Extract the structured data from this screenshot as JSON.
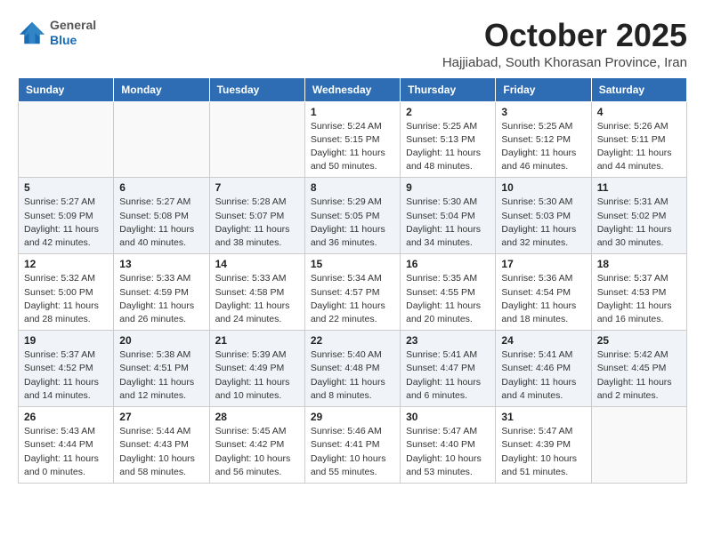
{
  "logo": {
    "general": "General",
    "blue": "Blue"
  },
  "header": {
    "month": "October 2025",
    "location": "Hajjiabad, South Khorasan Province, Iran"
  },
  "weekdays": [
    "Sunday",
    "Monday",
    "Tuesday",
    "Wednesday",
    "Thursday",
    "Friday",
    "Saturday"
  ],
  "weeks": [
    [
      {
        "day": "",
        "info": ""
      },
      {
        "day": "",
        "info": ""
      },
      {
        "day": "",
        "info": ""
      },
      {
        "day": "1",
        "info": "Sunrise: 5:24 AM\nSunset: 5:15 PM\nDaylight: 11 hours\nand 50 minutes."
      },
      {
        "day": "2",
        "info": "Sunrise: 5:25 AM\nSunset: 5:13 PM\nDaylight: 11 hours\nand 48 minutes."
      },
      {
        "day": "3",
        "info": "Sunrise: 5:25 AM\nSunset: 5:12 PM\nDaylight: 11 hours\nand 46 minutes."
      },
      {
        "day": "4",
        "info": "Sunrise: 5:26 AM\nSunset: 5:11 PM\nDaylight: 11 hours\nand 44 minutes."
      }
    ],
    [
      {
        "day": "5",
        "info": "Sunrise: 5:27 AM\nSunset: 5:09 PM\nDaylight: 11 hours\nand 42 minutes."
      },
      {
        "day": "6",
        "info": "Sunrise: 5:27 AM\nSunset: 5:08 PM\nDaylight: 11 hours\nand 40 minutes."
      },
      {
        "day": "7",
        "info": "Sunrise: 5:28 AM\nSunset: 5:07 PM\nDaylight: 11 hours\nand 38 minutes."
      },
      {
        "day": "8",
        "info": "Sunrise: 5:29 AM\nSunset: 5:05 PM\nDaylight: 11 hours\nand 36 minutes."
      },
      {
        "day": "9",
        "info": "Sunrise: 5:30 AM\nSunset: 5:04 PM\nDaylight: 11 hours\nand 34 minutes."
      },
      {
        "day": "10",
        "info": "Sunrise: 5:30 AM\nSunset: 5:03 PM\nDaylight: 11 hours\nand 32 minutes."
      },
      {
        "day": "11",
        "info": "Sunrise: 5:31 AM\nSunset: 5:02 PM\nDaylight: 11 hours\nand 30 minutes."
      }
    ],
    [
      {
        "day": "12",
        "info": "Sunrise: 5:32 AM\nSunset: 5:00 PM\nDaylight: 11 hours\nand 28 minutes."
      },
      {
        "day": "13",
        "info": "Sunrise: 5:33 AM\nSunset: 4:59 PM\nDaylight: 11 hours\nand 26 minutes."
      },
      {
        "day": "14",
        "info": "Sunrise: 5:33 AM\nSunset: 4:58 PM\nDaylight: 11 hours\nand 24 minutes."
      },
      {
        "day": "15",
        "info": "Sunrise: 5:34 AM\nSunset: 4:57 PM\nDaylight: 11 hours\nand 22 minutes."
      },
      {
        "day": "16",
        "info": "Sunrise: 5:35 AM\nSunset: 4:55 PM\nDaylight: 11 hours\nand 20 minutes."
      },
      {
        "day": "17",
        "info": "Sunrise: 5:36 AM\nSunset: 4:54 PM\nDaylight: 11 hours\nand 18 minutes."
      },
      {
        "day": "18",
        "info": "Sunrise: 5:37 AM\nSunset: 4:53 PM\nDaylight: 11 hours\nand 16 minutes."
      }
    ],
    [
      {
        "day": "19",
        "info": "Sunrise: 5:37 AM\nSunset: 4:52 PM\nDaylight: 11 hours\nand 14 minutes."
      },
      {
        "day": "20",
        "info": "Sunrise: 5:38 AM\nSunset: 4:51 PM\nDaylight: 11 hours\nand 12 minutes."
      },
      {
        "day": "21",
        "info": "Sunrise: 5:39 AM\nSunset: 4:49 PM\nDaylight: 11 hours\nand 10 minutes."
      },
      {
        "day": "22",
        "info": "Sunrise: 5:40 AM\nSunset: 4:48 PM\nDaylight: 11 hours\nand 8 minutes."
      },
      {
        "day": "23",
        "info": "Sunrise: 5:41 AM\nSunset: 4:47 PM\nDaylight: 11 hours\nand 6 minutes."
      },
      {
        "day": "24",
        "info": "Sunrise: 5:41 AM\nSunset: 4:46 PM\nDaylight: 11 hours\nand 4 minutes."
      },
      {
        "day": "25",
        "info": "Sunrise: 5:42 AM\nSunset: 4:45 PM\nDaylight: 11 hours\nand 2 minutes."
      }
    ],
    [
      {
        "day": "26",
        "info": "Sunrise: 5:43 AM\nSunset: 4:44 PM\nDaylight: 11 hours\nand 0 minutes."
      },
      {
        "day": "27",
        "info": "Sunrise: 5:44 AM\nSunset: 4:43 PM\nDaylight: 10 hours\nand 58 minutes."
      },
      {
        "day": "28",
        "info": "Sunrise: 5:45 AM\nSunset: 4:42 PM\nDaylight: 10 hours\nand 56 minutes."
      },
      {
        "day": "29",
        "info": "Sunrise: 5:46 AM\nSunset: 4:41 PM\nDaylight: 10 hours\nand 55 minutes."
      },
      {
        "day": "30",
        "info": "Sunrise: 5:47 AM\nSunset: 4:40 PM\nDaylight: 10 hours\nand 53 minutes."
      },
      {
        "day": "31",
        "info": "Sunrise: 5:47 AM\nSunset: 4:39 PM\nDaylight: 10 hours\nand 51 minutes."
      },
      {
        "day": "",
        "info": ""
      }
    ]
  ]
}
